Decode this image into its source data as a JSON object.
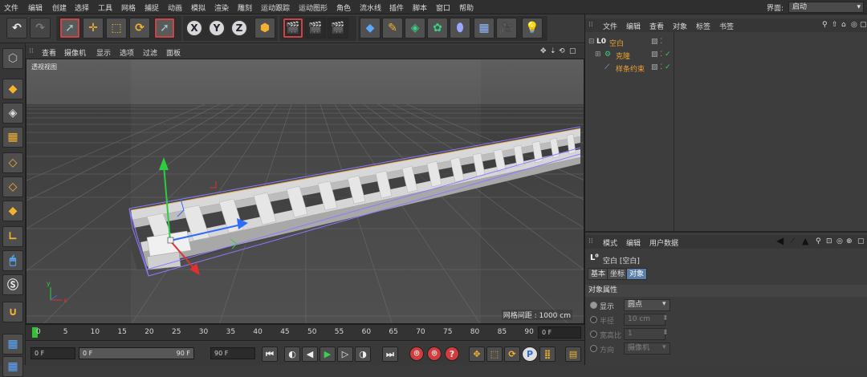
{
  "menu": {
    "items": [
      "文件",
      "编辑",
      "创建",
      "选择",
      "工具",
      "网格",
      "捕捉",
      "动画",
      "模拟",
      "渲染",
      "雕刻",
      "运动跟踪",
      "运动图形",
      "角色",
      "流水线",
      "插件",
      "脚本",
      "窗口",
      "帮助"
    ],
    "layout_label": "界面:",
    "layout_value": "启动"
  },
  "toolbar": {
    "x_label": "X",
    "y_label": "Y",
    "z_label": "Z"
  },
  "viewport": {
    "menu": [
      "查看",
      "摄像机",
      "显示",
      "选项",
      "过滤",
      "面板"
    ],
    "view_name": "透视视图",
    "grid_spacing": "网格间距 : 1000 cm",
    "axis_y": "y",
    "axis_x": "x",
    "colors": {
      "y_axis": "#2ecc40",
      "x_axis": "#e03030",
      "z_axis": "#2f6bff",
      "bbox": "#8a7cff"
    }
  },
  "timeline": {
    "ticks": [
      "0",
      "5",
      "10",
      "15",
      "20",
      "25",
      "30",
      "35",
      "40",
      "45",
      "50",
      "55",
      "60",
      "65",
      "70",
      "75",
      "80",
      "85",
      "90"
    ],
    "current_frame": "0 F",
    "start_frame": "0 F",
    "range_start": "0 F",
    "range_end": "90 F",
    "end_frame": "90 F"
  },
  "objects": {
    "menu": [
      "文件",
      "编辑",
      "查看",
      "对象",
      "标签",
      "书签"
    ],
    "rows": [
      {
        "name": "空白",
        "prefix": "L0",
        "color": "#f0a030"
      },
      {
        "name": "克隆",
        "prefix": "⚙",
        "color": "#f0a030"
      },
      {
        "name": "样条约束",
        "prefix": "⟋",
        "color": "#f0a030"
      }
    ]
  },
  "attributes": {
    "menu": [
      "模式",
      "编辑",
      "用户数据"
    ],
    "object_title": "空白 [空白]",
    "tabs": [
      "基本",
      "坐标",
      "对象"
    ],
    "section": "对象属性",
    "fields": [
      {
        "label": "显示",
        "value": "圆点",
        "enabled": true
      },
      {
        "label": "半径",
        "value": "10 cm",
        "enabled": false
      },
      {
        "label": "宽高比",
        "value": "1",
        "enabled": false
      },
      {
        "label": "方向",
        "value": "摄像机",
        "enabled": false
      }
    ]
  }
}
